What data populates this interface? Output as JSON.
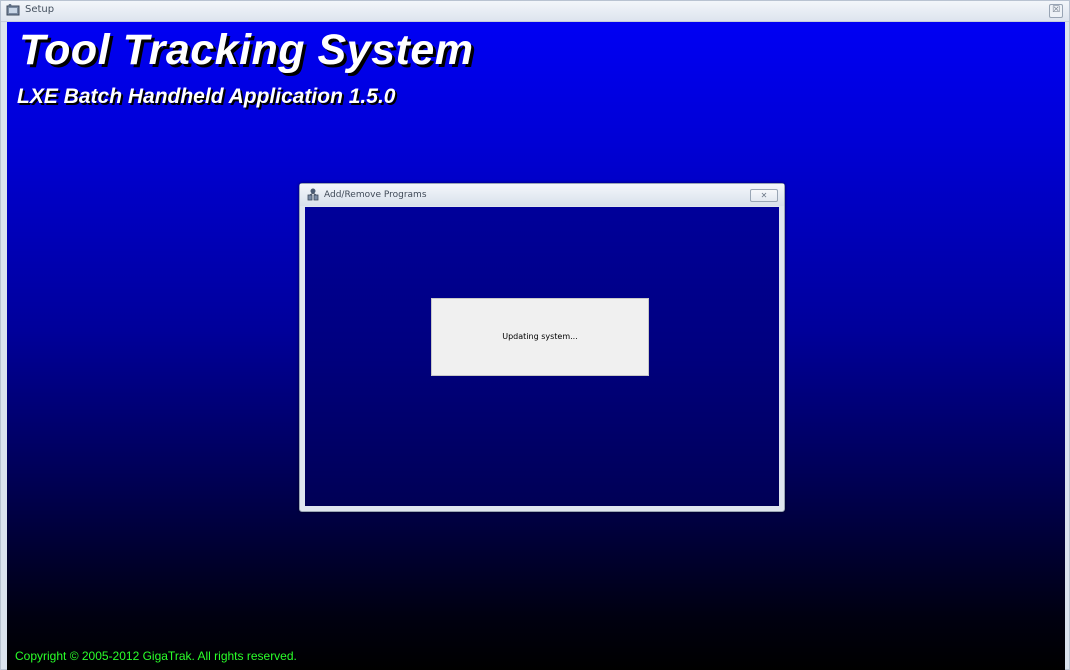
{
  "window": {
    "title": "Setup",
    "icon": "setup-icon",
    "close_glyph": "☒"
  },
  "app": {
    "title": "Tool Tracking System",
    "subtitle": "LXE Batch Handheld Application 1.5.0",
    "copyright": "Copyright © 2005-2012 GigaTrak. All rights reserved."
  },
  "dialog": {
    "title": "Add/Remove Programs",
    "icon": "add-remove-programs-icon",
    "close_glyph": "✕",
    "status_text": "Updating system..."
  },
  "colors": {
    "background_top": "#0000f4",
    "background_bottom": "#000000",
    "copyright_text": "#2aff2a",
    "title_text": "#ffffff"
  }
}
